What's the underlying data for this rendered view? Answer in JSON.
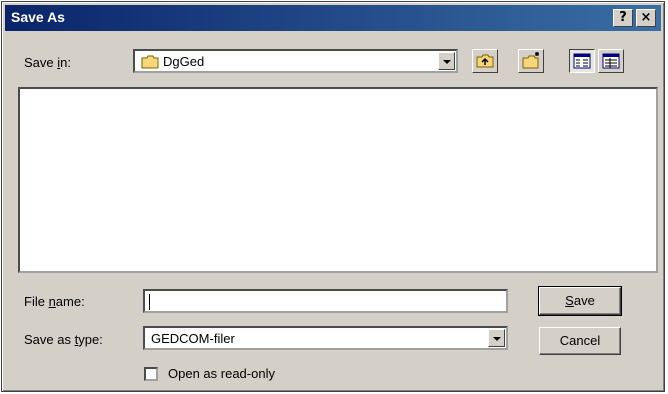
{
  "window": {
    "title": "Save As",
    "help_label": "?",
    "close_label": "×"
  },
  "save_in": {
    "label_pre": "Save ",
    "label_key": "i",
    "label_post": "n:",
    "value": "DgGed"
  },
  "file_name": {
    "label_pre": "File ",
    "label_key": "n",
    "label_post": "ame:",
    "value": ""
  },
  "save_as_type": {
    "label_pre": "Save as ",
    "label_key": "t",
    "label_post": "ype:",
    "value": "GEDCOM-filer"
  },
  "open_read_only": {
    "label": "Open as read-only",
    "checked": false
  },
  "buttons": {
    "save_key": "S",
    "save_rest": "ave",
    "cancel": "Cancel"
  },
  "toolbar": {
    "icons": [
      "up-one-level-icon",
      "create-new-folder-icon",
      "list-view-icon",
      "details-view-icon"
    ]
  },
  "colors": {
    "titlebar_start": "#0a246a",
    "titlebar_end": "#3a6ea5",
    "face": "#d4d0c8",
    "folder": "#f5d67a"
  }
}
